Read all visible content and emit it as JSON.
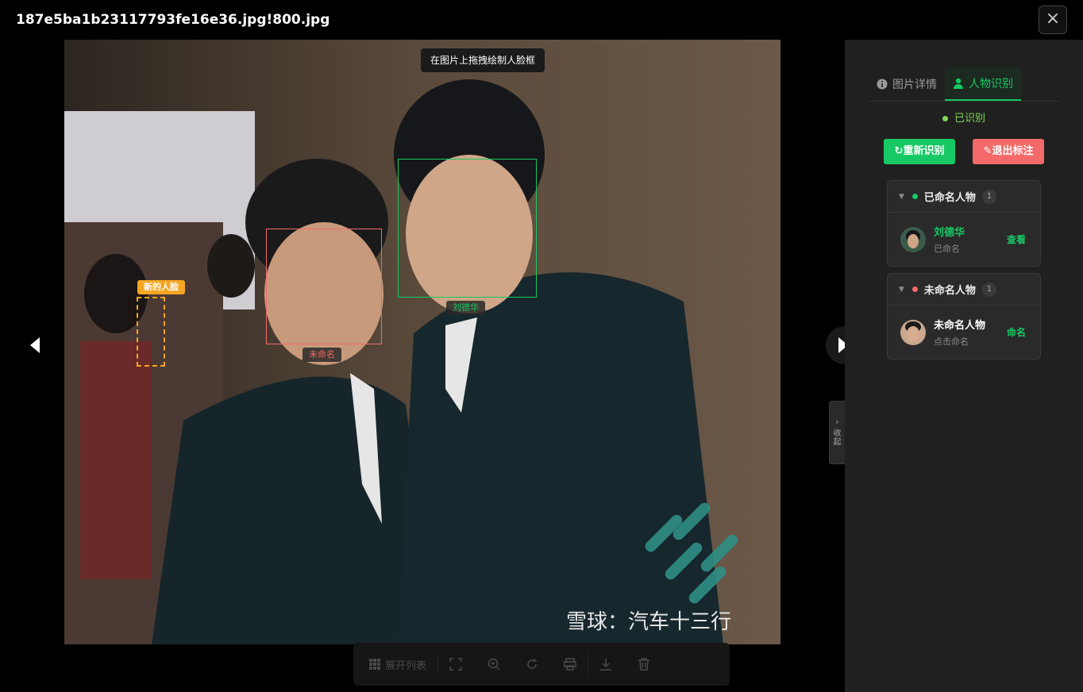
{
  "window": {
    "title": "187e5ba1b23117793fe16e36.jpg!800.jpg",
    "close_icon": "×"
  },
  "viewer": {
    "hint": "在图片上拖拽绘制人脸框",
    "faces": {
      "new_face_label": "新的人脸",
      "unnamed_label": "未命名",
      "named_label": "刘德华"
    },
    "watermark": "雪球：汽车十三行"
  },
  "toolbar": {
    "expand_list_label": "展开列表"
  },
  "collapse": {
    "label": "收起"
  },
  "panel": {
    "tabs": [
      {
        "label": "图片详情",
        "icon": "info-icon"
      },
      {
        "label": "人物识别",
        "icon": "person-icon"
      }
    ],
    "status": "已识别",
    "re_recognize_label": "重新识别",
    "exit_label": "退出标注",
    "named_group": {
      "title": "已命名人物",
      "count": "1",
      "person": {
        "name": "刘德华",
        "status": "已命名",
        "action": "查看"
      }
    },
    "unnamed_group": {
      "title": "未命名人物",
      "count": "1",
      "person": {
        "name": "未命名人物",
        "status": "点击命名",
        "action": "命名"
      }
    }
  },
  "colors": {
    "accent": "#17c964",
    "danger": "#f46a6a",
    "warning": "#f5a623",
    "recognized": "#7ed957"
  }
}
